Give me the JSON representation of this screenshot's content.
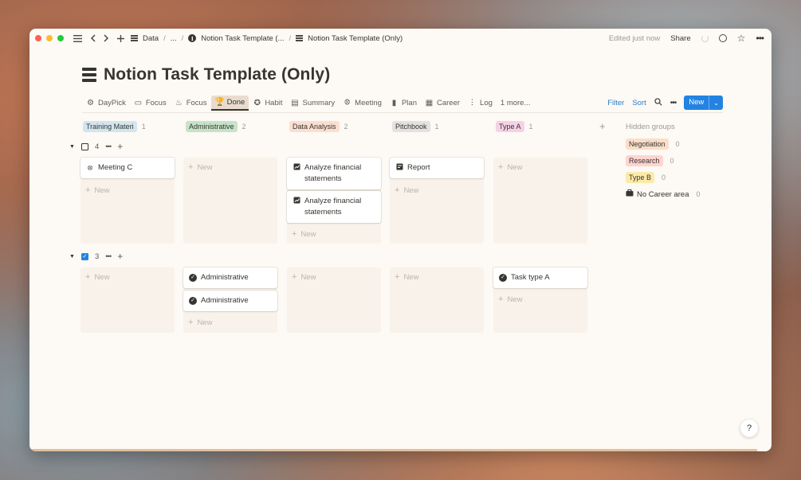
{
  "titlebar": {
    "lights": [
      "#ff5f57",
      "#febc2e",
      "#28c840"
    ],
    "crumbs": [
      "Data",
      "...",
      "Notion Task Template (...",
      "Notion Task Template (Only)"
    ],
    "edited": "Edited just now",
    "share": "Share"
  },
  "page": {
    "title": "Notion Task Template (Only)"
  },
  "views": [
    {
      "label": "DayPick",
      "icon": "gear-icon"
    },
    {
      "label": "Focus",
      "icon": "image-icon"
    },
    {
      "label": "Focus",
      "icon": "flame-icon"
    },
    {
      "label": "Done",
      "icon": "trophy-icon",
      "active": true
    },
    {
      "label": "Habit",
      "icon": "badge-icon"
    },
    {
      "label": "Summary",
      "icon": "stack-icon"
    },
    {
      "label": "Meeting",
      "icon": "people-icon"
    },
    {
      "label": "Plan",
      "icon": "clipboard-icon"
    },
    {
      "label": "Career",
      "icon": "calendar-icon"
    },
    {
      "label": "Log",
      "icon": "footprints-icon"
    },
    {
      "label": "1 more...",
      "icon": ""
    }
  ],
  "toolbar": {
    "filter": "Filter",
    "sort": "Sort",
    "new": "New"
  },
  "columns": [
    {
      "name": "Training Materi",
      "count": "1",
      "color": "#d3e5ef"
    },
    {
      "name": "Administrative",
      "count": "2",
      "color": "#c6e3c9"
    },
    {
      "name": "Data Analysis",
      "count": "2",
      "color": "#fadfd0"
    },
    {
      "name": "Pitchbook",
      "count": "1",
      "color": "#e3e2e0"
    },
    {
      "name": "Type A",
      "count": "1",
      "color": "#f5d1e6"
    }
  ],
  "groups": [
    {
      "count": "4",
      "checked": false,
      "cards": {
        "col0": [
          {
            "title": "Meeting C",
            "icon": "people-icon"
          }
        ],
        "col2": [
          {
            "title": "Analyze financial statements",
            "icon": "chart-icon"
          },
          {
            "title": "Analyze financial statements",
            "icon": "chart-icon"
          }
        ],
        "col3": [
          {
            "title": "Report",
            "icon": "report-icon"
          }
        ]
      }
    },
    {
      "count": "3",
      "checked": true,
      "cards": {
        "col1": [
          {
            "title": "Administrative",
            "icon": "check-circle-icon"
          },
          {
            "title": "Administrative",
            "icon": "check-circle-icon"
          }
        ],
        "col4": [
          {
            "title": "Task type A",
            "icon": "check-circle-icon"
          }
        ]
      }
    }
  ],
  "new_label": "New",
  "hidden_groups": {
    "title": "Hidden groups",
    "items": [
      {
        "name": "Negotiation",
        "count": "0",
        "color": "#fadec9"
      },
      {
        "name": "Research",
        "count": "0",
        "color": "#ffd4d0"
      },
      {
        "name": "Type B",
        "count": "0",
        "color": "#fbeaa8"
      },
      {
        "name": "No Career area",
        "count": "0",
        "color": ""
      }
    ]
  },
  "help": "?"
}
